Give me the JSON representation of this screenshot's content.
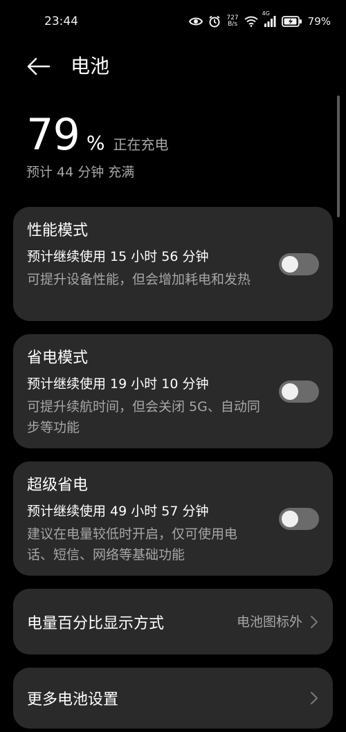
{
  "status_bar": {
    "time": "23:44",
    "net_speed_value": "727",
    "net_speed_unit": "B/s",
    "network_type": "4G",
    "battery_text": "79%"
  },
  "header": {
    "title": "电池"
  },
  "battery": {
    "percent": "79",
    "percent_sign": "%",
    "status": "正在充电",
    "eta": "预计 44 分钟 充满"
  },
  "modes": [
    {
      "title": "性能模式",
      "estimate": "预计继续使用 15 小时 56 分钟",
      "description": "可提升设备性能，但会增加耗电和发热",
      "enabled": false
    },
    {
      "title": "省电模式",
      "estimate": "预计继续使用 19 小时 10 分钟",
      "description": "可提升续航时间，但会关闭 5G、自动同步等功能",
      "enabled": false
    },
    {
      "title": "超级省电",
      "estimate": "预计继续使用 49 小时 57 分钟",
      "description": "建议在电量较低时开启，仅可使用电话、短信、网络等基础功能",
      "enabled": false
    }
  ],
  "percentage_display": {
    "label": "电量百分比显示方式",
    "value": "电池图标外"
  },
  "more_settings": {
    "label": "更多电池设置"
  },
  "colors": {
    "background": "#000000",
    "card": "#2a2a2a",
    "secondary_text": "#a6a6a6",
    "toggle_off": "#6b6b6b"
  }
}
